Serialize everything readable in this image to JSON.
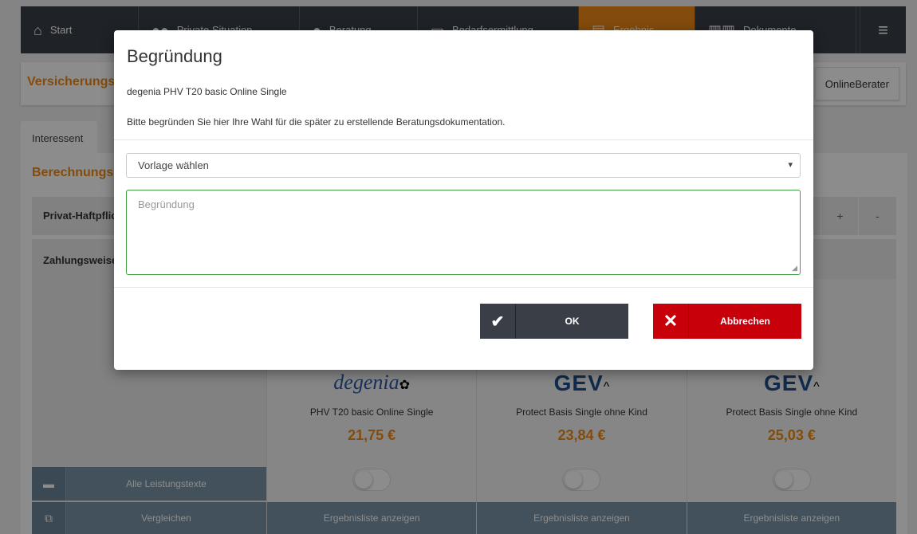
{
  "nav": {
    "items": [
      {
        "label": "Start",
        "icon": "home-icon",
        "glyph": "⌂",
        "active": false
      },
      {
        "label": "Private Situation",
        "icon": "people-icon",
        "glyph": "●●",
        "active": false
      },
      {
        "label": "Beratung",
        "icon": "chat-icon",
        "glyph": "●",
        "active": false
      },
      {
        "label": "Bedarfsermittlung",
        "icon": "monitor-icon",
        "glyph": "▭",
        "active": false
      },
      {
        "label": "Ergebnis",
        "icon": "clipboard-icon",
        "glyph": "▤",
        "active": true
      },
      {
        "label": "Dokumente",
        "icon": "documents-icon",
        "glyph": "▥▥",
        "active": false
      }
    ],
    "menu_glyph": "≡",
    "active_color": "#ef8a16"
  },
  "header": {
    "title": "Versicherungsvergleich",
    "online_button": "OnlineBerater"
  },
  "tabs": {
    "interessent": "Interessent"
  },
  "section": {
    "title": "Berechnungsergebnis",
    "privat_label": "Privat-Haftpflicht",
    "plus": "+",
    "minus": "-",
    "zahlung_label": "Zahlungsweise"
  },
  "products": [
    {
      "logo": "degenia",
      "name": "PHV T20 basic Online Single",
      "price": "21,75 €",
      "button": "Ergebnisliste anzeigen"
    },
    {
      "logo": "GEV",
      "name": "Protect Basis Single ohne Kind",
      "price": "23,84 €",
      "button": "Ergebnisliste anzeigen"
    },
    {
      "logo": "GEV",
      "name": "Protect Basis Single ohne Kind",
      "price": "25,03 €",
      "button": "Ergebnisliste anzeigen"
    }
  ],
  "sidebar": {
    "alle": "Alle Leistungstexte",
    "vergleichen": "Vergleichen"
  },
  "modal": {
    "title": "Begründung",
    "product": "degenia PHV T20 basic Online Single",
    "hint": "Bitte begründen Sie hier Ihre Wahl für die später zu erstellende Beratungsdokumentation.",
    "select_value": "Vorlage wählen",
    "textarea_placeholder": "Begründung",
    "ok_label": "OK",
    "cancel_label": "Abbrechen"
  },
  "colors": {
    "accent": "#ef8a16",
    "dark": "#3a3f47",
    "cancel": "#c8000a",
    "focus_border": "#3fa142",
    "button_blue_grey": "#7994a6"
  }
}
